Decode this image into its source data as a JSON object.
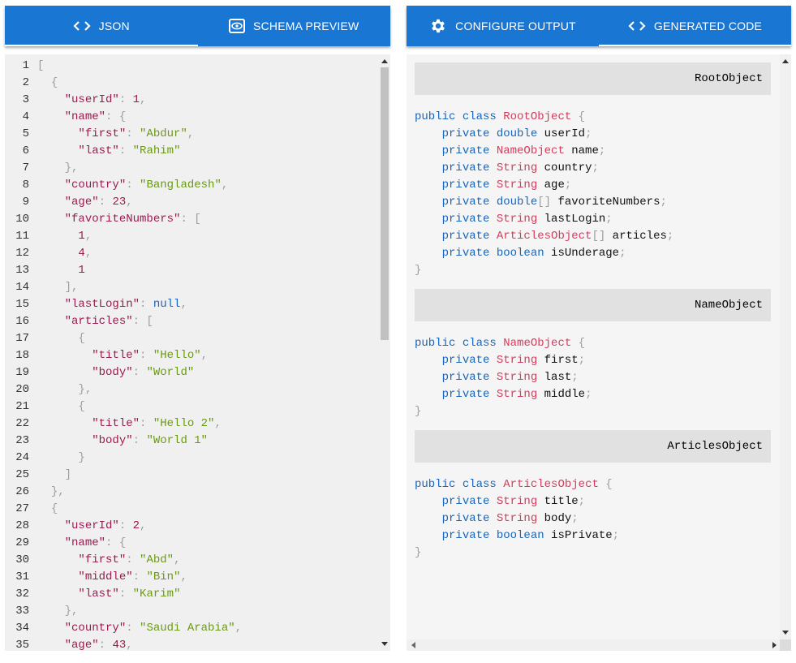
{
  "left_tabs": [
    {
      "label": "JSON",
      "icon": "code-icon",
      "active": true
    },
    {
      "label": "SCHEMA PREVIEW",
      "icon": "eye-icon",
      "active": false
    }
  ],
  "right_tabs": [
    {
      "label": "CONFIGURE OUTPUT",
      "icon": "gear-icon",
      "active": false
    },
    {
      "label": "GENERATED CODE",
      "icon": "code-icon",
      "active": true
    }
  ],
  "json_editor": {
    "lines": [
      {
        "n": "1",
        "t": [
          [
            "p",
            "["
          ]
        ]
      },
      {
        "n": "2",
        "t": [
          [
            "w",
            "  "
          ],
          [
            "p",
            "{"
          ]
        ]
      },
      {
        "n": "3",
        "t": [
          [
            "w",
            "    "
          ],
          [
            "k",
            "\"userId\""
          ],
          [
            "p",
            ": "
          ],
          [
            "n",
            "1"
          ],
          [
            "p",
            ","
          ]
        ]
      },
      {
        "n": "4",
        "t": [
          [
            "w",
            "    "
          ],
          [
            "k",
            "\"name\""
          ],
          [
            "p",
            ": {"
          ]
        ]
      },
      {
        "n": "5",
        "t": [
          [
            "w",
            "      "
          ],
          [
            "k",
            "\"first\""
          ],
          [
            "p",
            ": "
          ],
          [
            "s",
            "\"Abdur\""
          ],
          [
            "p",
            ","
          ]
        ]
      },
      {
        "n": "6",
        "t": [
          [
            "w",
            "      "
          ],
          [
            "k",
            "\"last\""
          ],
          [
            "p",
            ": "
          ],
          [
            "s",
            "\"Rahim\""
          ]
        ]
      },
      {
        "n": "7",
        "t": [
          [
            "w",
            "    "
          ],
          [
            "p",
            "},"
          ]
        ]
      },
      {
        "n": "8",
        "t": [
          [
            "w",
            "    "
          ],
          [
            "k",
            "\"country\""
          ],
          [
            "p",
            ": "
          ],
          [
            "s",
            "\"Bangladesh\""
          ],
          [
            "p",
            ","
          ]
        ]
      },
      {
        "n": "9",
        "t": [
          [
            "w",
            "    "
          ],
          [
            "k",
            "\"age\""
          ],
          [
            "p",
            ": "
          ],
          [
            "n",
            "23"
          ],
          [
            "p",
            ","
          ]
        ]
      },
      {
        "n": "10",
        "t": [
          [
            "w",
            "    "
          ],
          [
            "k",
            "\"favoriteNumbers\""
          ],
          [
            "p",
            ": ["
          ]
        ]
      },
      {
        "n": "11",
        "t": [
          [
            "w",
            "      "
          ],
          [
            "n",
            "1"
          ],
          [
            "p",
            ","
          ]
        ]
      },
      {
        "n": "12",
        "t": [
          [
            "w",
            "      "
          ],
          [
            "n",
            "4"
          ],
          [
            "p",
            ","
          ]
        ]
      },
      {
        "n": "13",
        "t": [
          [
            "w",
            "      "
          ],
          [
            "n",
            "1"
          ]
        ]
      },
      {
        "n": "14",
        "t": [
          [
            "w",
            "    "
          ],
          [
            "p",
            "],"
          ]
        ]
      },
      {
        "n": "15",
        "t": [
          [
            "w",
            "    "
          ],
          [
            "k",
            "\"lastLogin\""
          ],
          [
            "p",
            ": "
          ],
          [
            "kw",
            "null"
          ],
          [
            "p",
            ","
          ]
        ]
      },
      {
        "n": "16",
        "t": [
          [
            "w",
            "    "
          ],
          [
            "k",
            "\"articles\""
          ],
          [
            "p",
            ": ["
          ]
        ]
      },
      {
        "n": "17",
        "t": [
          [
            "w",
            "      "
          ],
          [
            "p",
            "{"
          ]
        ]
      },
      {
        "n": "18",
        "t": [
          [
            "w",
            "        "
          ],
          [
            "k",
            "\"title\""
          ],
          [
            "p",
            ": "
          ],
          [
            "s",
            "\"Hello\""
          ],
          [
            "p",
            ","
          ]
        ]
      },
      {
        "n": "19",
        "t": [
          [
            "w",
            "        "
          ],
          [
            "k",
            "\"body\""
          ],
          [
            "p",
            ": "
          ],
          [
            "s",
            "\"World\""
          ]
        ]
      },
      {
        "n": "20",
        "t": [
          [
            "w",
            "      "
          ],
          [
            "p",
            "},"
          ]
        ]
      },
      {
        "n": "21",
        "t": [
          [
            "w",
            "      "
          ],
          [
            "p",
            "{"
          ]
        ]
      },
      {
        "n": "22",
        "t": [
          [
            "w",
            "        "
          ],
          [
            "k",
            "\"title\""
          ],
          [
            "p",
            ": "
          ],
          [
            "s",
            "\"Hello 2\""
          ],
          [
            "p",
            ","
          ]
        ]
      },
      {
        "n": "23",
        "t": [
          [
            "w",
            "        "
          ],
          [
            "k",
            "\"body\""
          ],
          [
            "p",
            ": "
          ],
          [
            "s",
            "\"World 1\""
          ]
        ]
      },
      {
        "n": "24",
        "t": [
          [
            "w",
            "      "
          ],
          [
            "p",
            "}"
          ]
        ]
      },
      {
        "n": "25",
        "t": [
          [
            "w",
            "    "
          ],
          [
            "p",
            "]"
          ]
        ]
      },
      {
        "n": "26",
        "t": [
          [
            "w",
            "  "
          ],
          [
            "p",
            "},"
          ]
        ]
      },
      {
        "n": "27",
        "t": [
          [
            "w",
            "  "
          ],
          [
            "p",
            "{"
          ]
        ]
      },
      {
        "n": "28",
        "t": [
          [
            "w",
            "    "
          ],
          [
            "k",
            "\"userId\""
          ],
          [
            "p",
            ": "
          ],
          [
            "n",
            "2"
          ],
          [
            "p",
            ","
          ]
        ]
      },
      {
        "n": "29",
        "t": [
          [
            "w",
            "    "
          ],
          [
            "k",
            "\"name\""
          ],
          [
            "p",
            ": {"
          ]
        ]
      },
      {
        "n": "30",
        "t": [
          [
            "w",
            "      "
          ],
          [
            "k",
            "\"first\""
          ],
          [
            "p",
            ": "
          ],
          [
            "s",
            "\"Abd\""
          ],
          [
            "p",
            ","
          ]
        ]
      },
      {
        "n": "31",
        "t": [
          [
            "w",
            "      "
          ],
          [
            "k",
            "\"middle\""
          ],
          [
            "p",
            ": "
          ],
          [
            "s",
            "\"Bin\""
          ],
          [
            "p",
            ","
          ]
        ]
      },
      {
        "n": "32",
        "t": [
          [
            "w",
            "      "
          ],
          [
            "k",
            "\"last\""
          ],
          [
            "p",
            ": "
          ],
          [
            "s",
            "\"Karim\""
          ]
        ]
      },
      {
        "n": "33",
        "t": [
          [
            "w",
            "    "
          ],
          [
            "p",
            "},"
          ]
        ]
      },
      {
        "n": "34",
        "t": [
          [
            "w",
            "    "
          ],
          [
            "k",
            "\"country\""
          ],
          [
            "p",
            ": "
          ],
          [
            "s",
            "\"Saudi Arabia\""
          ],
          [
            "p",
            ","
          ]
        ]
      },
      {
        "n": "35",
        "t": [
          [
            "w",
            "    "
          ],
          [
            "k",
            "\"age\""
          ],
          [
            "p",
            ": "
          ],
          [
            "n",
            "43"
          ],
          [
            "p",
            ","
          ]
        ]
      }
    ]
  },
  "generated_code": {
    "classes": [
      {
        "name": "RootObject",
        "header_label": "RootObject",
        "fields": [
          {
            "type": "double",
            "kind": "prim",
            "name": "userId",
            "array": false
          },
          {
            "type": "NameObject",
            "kind": "obj",
            "name": "name",
            "array": false
          },
          {
            "type": "String",
            "kind": "obj",
            "name": "country",
            "array": false
          },
          {
            "type": "String",
            "kind": "obj",
            "name": "age",
            "array": false
          },
          {
            "type": "double",
            "kind": "prim",
            "name": "favoriteNumbers",
            "array": true
          },
          {
            "type": "String",
            "kind": "obj",
            "name": "lastLogin",
            "array": false
          },
          {
            "type": "ArticlesObject",
            "kind": "obj",
            "name": "articles",
            "array": true
          },
          {
            "type": "boolean",
            "kind": "prim",
            "name": "isUnderage",
            "array": false
          }
        ]
      },
      {
        "name": "NameObject",
        "header_label": "NameObject",
        "fields": [
          {
            "type": "String",
            "kind": "obj",
            "name": "first",
            "array": false
          },
          {
            "type": "String",
            "kind": "obj",
            "name": "last",
            "array": false
          },
          {
            "type": "String",
            "kind": "obj",
            "name": "middle",
            "array": false
          }
        ]
      },
      {
        "name": "ArticlesObject",
        "header_label": "ArticlesObject",
        "fields": [
          {
            "type": "String",
            "kind": "obj",
            "name": "title",
            "array": false
          },
          {
            "type": "String",
            "kind": "obj",
            "name": "body",
            "array": false
          },
          {
            "type": "boolean",
            "kind": "prim",
            "name": "isPrivate",
            "array": false
          }
        ]
      }
    ],
    "keywords": {
      "public": "public",
      "class": "class",
      "private": "private"
    }
  },
  "colors": {
    "tabbar": "#1976d2",
    "key": "#9b1b4e",
    "string": "#6a9a12",
    "keyword": "#1565c0",
    "class_name": "#d33d5c"
  }
}
